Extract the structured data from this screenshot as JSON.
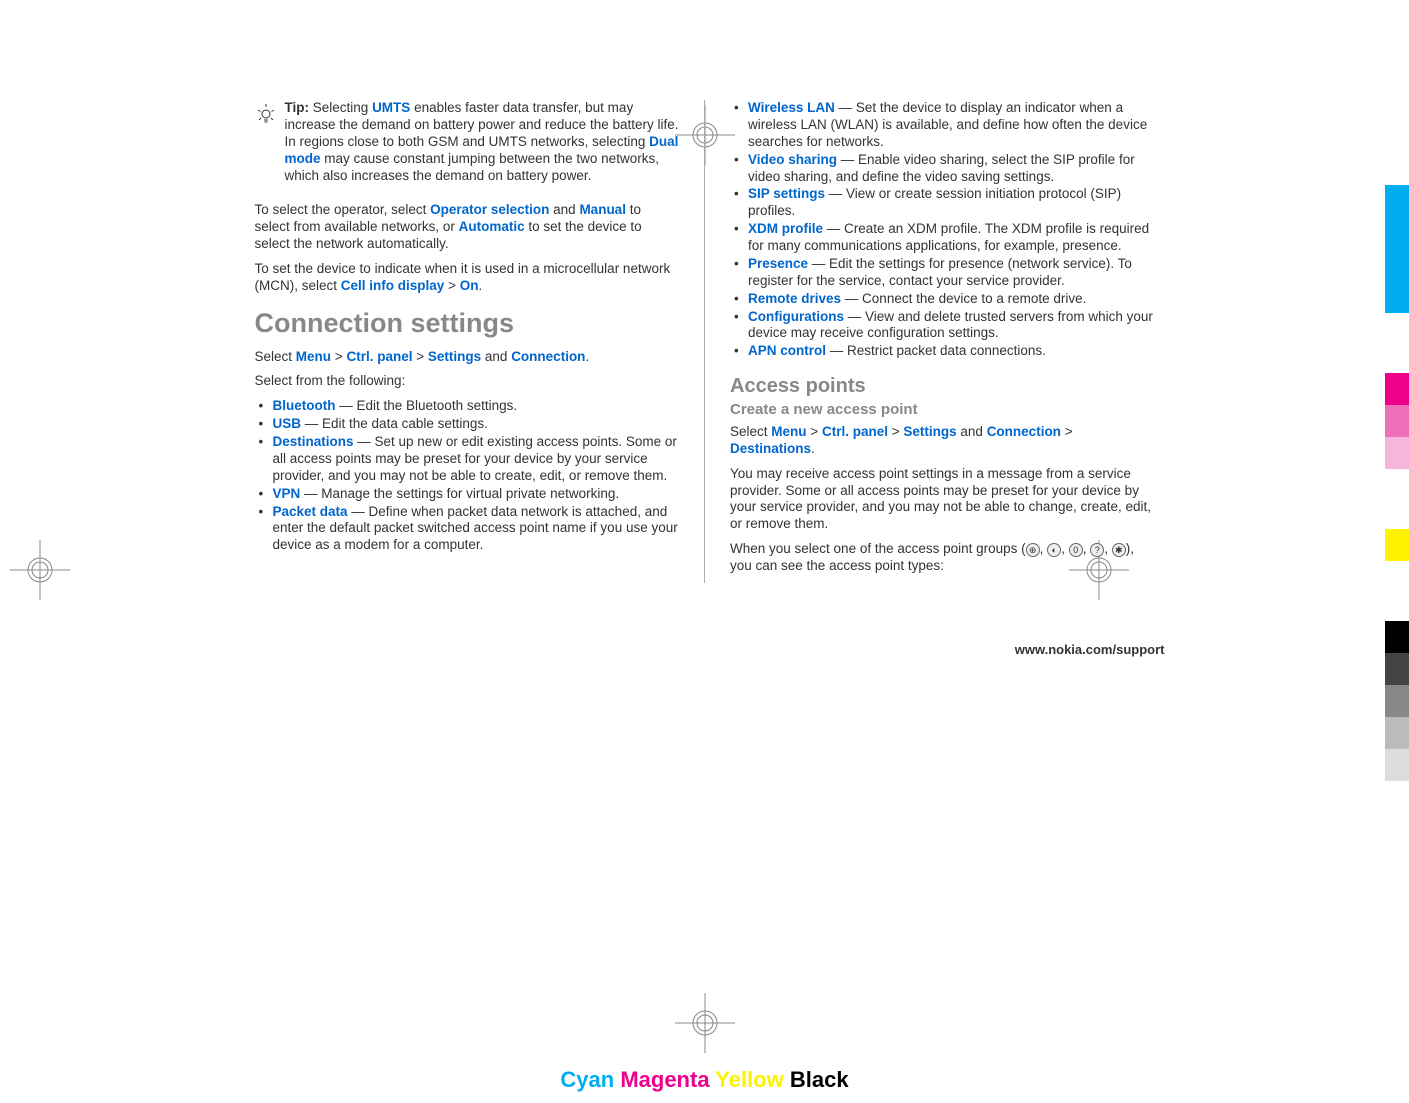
{
  "tip": {
    "label": "Tip:",
    "text1": "Selecting ",
    "umts": "UMTS",
    "text2": " enables faster data transfer, but may increase the demand on battery power and reduce the battery life. In regions close to both GSM and UMTS networks, selecting ",
    "dual": "Dual mode",
    "text3": " may cause constant jumping between the two networks, which also increases the demand on battery power."
  },
  "operator": {
    "t1": "To select the operator, select ",
    "op_sel": "Operator selection",
    "t2": " and ",
    "manual": "Manual",
    "t3": " to select from available networks, or ",
    "auto": "Automatic",
    "t4": " to set the device to select the network automatically."
  },
  "mcn": {
    "t1": "To set the device to indicate when it is used in a microcellular network (MCN), select ",
    "cid": "Cell info display",
    "gt": ">",
    "on": "On",
    "dot": "."
  },
  "conn_settings_title": "Connection settings",
  "conn_sel": {
    "t1": "Select ",
    "menu": "Menu",
    "gt": ">",
    "ctrl": "Ctrl. panel",
    "settings": "Settings",
    "t2": " and ",
    "connection": "Connection",
    "dot": "."
  },
  "select_from": "Select from the following:",
  "left_items": [
    {
      "label": "Bluetooth",
      "desc": " — Edit the Bluetooth settings."
    },
    {
      "label": "USB",
      "desc": " — Edit the data cable settings."
    },
    {
      "label": "Destinations",
      "desc": " — Set up new or edit existing access points. Some or all access points may be preset for your device by your service provider, and you may not be able to create, edit, or remove them."
    },
    {
      "label": "VPN",
      "desc": " — Manage the settings for virtual private networking."
    },
    {
      "label": "Packet data",
      "desc": " — Define when packet data network is attached, and enter the default packet switched access point name if you use your device as a modem for a computer."
    }
  ],
  "right_items": [
    {
      "label": "Wireless LAN",
      "desc": " — Set the device to display an indicator when a wireless LAN (WLAN) is available, and define how often the device searches for networks."
    },
    {
      "label": "Video sharing",
      "desc": " — Enable video sharing, select the SIP profile for video sharing, and define the video saving settings."
    },
    {
      "label": "SIP settings",
      "desc": " — View or create session initiation protocol (SIP) profiles."
    },
    {
      "label": "XDM profile",
      "desc": " — Create an XDM profile. The XDM profile is required for many communications applications, for example, presence."
    },
    {
      "label": "Presence",
      "desc": " — Edit the settings for presence (network service). To register for the service, contact your service provider."
    },
    {
      "label": "Remote drives",
      "desc": " — Connect the device to a remote drive."
    },
    {
      "label": "Configurations",
      "desc": " — View and delete trusted servers from which your device may receive configuration settings."
    },
    {
      "label": "APN control",
      "desc": " — Restrict packet data connections."
    }
  ],
  "access_points_title": "Access points",
  "create_ap_title": "Create a new access point",
  "ap_sel": {
    "t1": "Select ",
    "menu": "Menu",
    "gt": ">",
    "ctrl": "Ctrl. panel",
    "settings": "Settings",
    "and": " and ",
    "connection": "Connection",
    "dest": "Destinations",
    "dot": "."
  },
  "ap_p1": "You may receive access point settings in a message from a service provider. Some or all access points may be preset for your device by your service provider, and you may not be able to change, create, edit, or remove them.",
  "ap_p2a": "When you select one of the access point groups (",
  "ap_p2b": "), you can see the access point types:",
  "footer_url": "www.nokia.com/support",
  "colorbar": {
    "cyan": "Cyan",
    "magenta": "Magenta",
    "yellow": "Yellow",
    "black": "Black"
  }
}
